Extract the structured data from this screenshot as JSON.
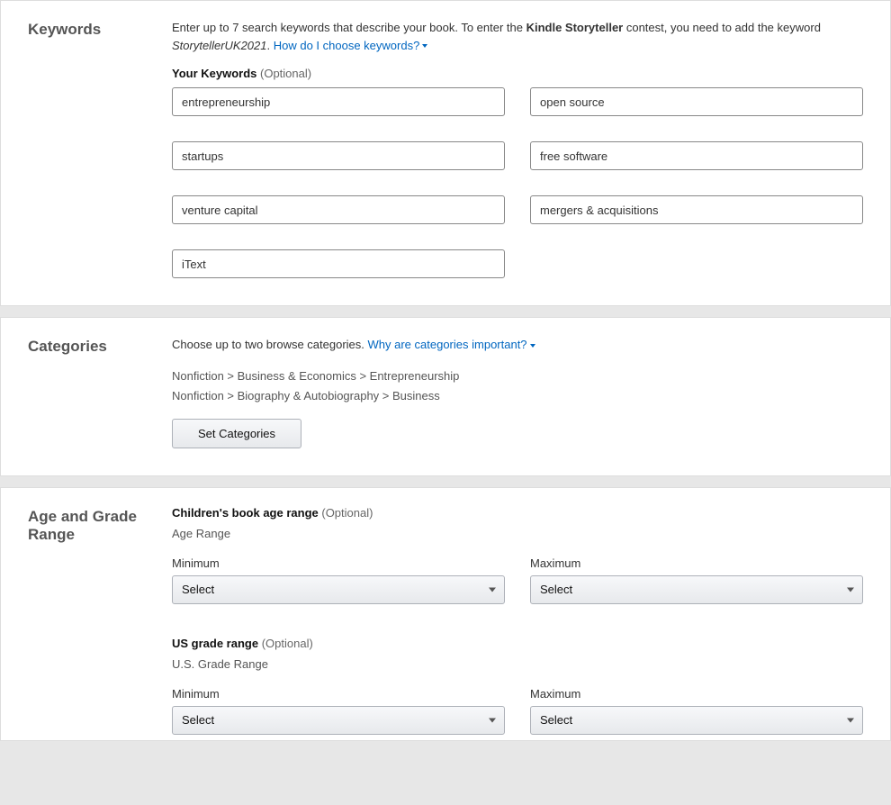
{
  "keywords": {
    "section_title": "Keywords",
    "hint_prefix": "Enter up to 7 search keywords that describe your book. To enter the ",
    "hint_bold": "Kindle Storyteller",
    "hint_mid": " contest, you need to add the keyword ",
    "hint_italic": "StorytellerUK2021",
    "hint_period": ". ",
    "hint_link": "How do I choose keywords?",
    "your_keywords": "Your Keywords ",
    "optional": "(Optional)",
    "values": [
      "entrepreneurship",
      "open source",
      "startups",
      "free software",
      "venture capital",
      "mergers & acquisitions",
      "iText"
    ]
  },
  "categories": {
    "section_title": "Categories",
    "hint_text": "Choose up to two browse categories. ",
    "hint_link": "Why are categories important?",
    "list": [
      "Nonfiction > Business & Economics > Entrepreneurship",
      "Nonfiction > Biography & Autobiography > Business"
    ],
    "button": "Set Categories"
  },
  "age": {
    "section_title": "Age and Grade Range",
    "age_heading": "Children's book age range ",
    "age_optional": "(Optional)",
    "age_sub": "Age Range",
    "min_label": "Minimum",
    "max_label": "Maximum",
    "select_placeholder": "Select",
    "grade_heading": "US grade range ",
    "grade_optional": "(Optional)",
    "grade_sub": "U.S. Grade Range"
  }
}
